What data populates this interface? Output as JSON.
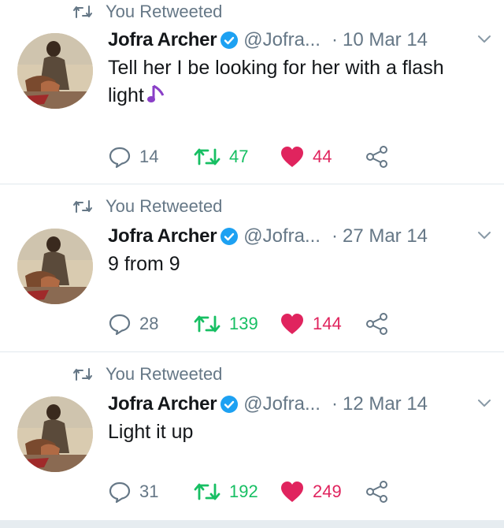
{
  "retweet_label": "You Retweeted",
  "tweets": [
    {
      "name": "Jofra Archer",
      "handle": "@Jofra...",
      "separator": "·",
      "date": "10 Mar 14",
      "text": "Tell her I be looking for her with a flash light",
      "emoji": "music-note-icon",
      "replies": "14",
      "retweets": "47",
      "likes": "44"
    },
    {
      "name": "Jofra Archer",
      "handle": "@Jofra...",
      "separator": "·",
      "date": "27 Mar 14",
      "text": "9 from 9",
      "replies": "28",
      "retweets": "139",
      "likes": "144"
    },
    {
      "name": "Jofra Archer",
      "handle": "@Jofra...",
      "separator": "·",
      "date": "12 Mar 14",
      "text": "Light it up",
      "replies": "31",
      "retweets": "192",
      "likes": "249"
    }
  ],
  "colors": {
    "retweet": "#17bf63",
    "like": "#e0245e",
    "secondary": "#657786",
    "verified": "#1da1f2",
    "note": "#8a3fc7"
  }
}
